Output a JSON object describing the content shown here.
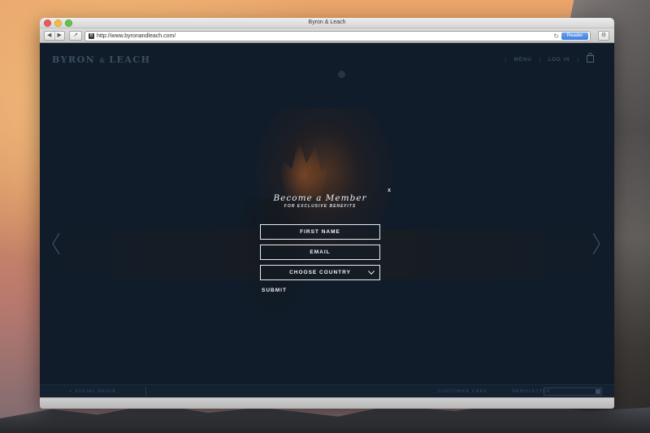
{
  "window": {
    "title": "Byron & Leach",
    "url": "http://www.byronandleach.com/",
    "reader_label": "Reader",
    "favicon_letter": "B"
  },
  "site": {
    "logo_main_left": "BYRON",
    "logo_amp": "&",
    "logo_main_right": "LEACH",
    "nav": {
      "menu": "MENU",
      "login": "LOG IN"
    }
  },
  "modal": {
    "close": "x",
    "title": "Become a Member",
    "subtitle": "FOR EXCLUSIVE BENEFITS",
    "first_name_placeholder": "FIRST NAME",
    "email_placeholder": "EMAIL",
    "country_selected": "CHOOSE COUNTRY",
    "submit_label": "SUBMIT"
  },
  "footer": {
    "social": "+ SOCIAL MEDIA",
    "customer_care": "CUSTOMER CARE",
    "newsletter": "NEWSLETTER"
  },
  "icons": {
    "back": "chevron-left-icon",
    "forward": "chevron-right-icon",
    "share": "share-icon",
    "reload": "reload-icon",
    "gear": "gear-icon",
    "bag": "shopping-bag-icon",
    "prev_slide": "chevron-left-icon",
    "next_slide": "chevron-right-icon",
    "dropdown": "chevron-down-icon"
  },
  "colors": {
    "page_background": "#101c29",
    "reader_button": "#3e7fe0",
    "modal_text": "#f1f3f6"
  }
}
